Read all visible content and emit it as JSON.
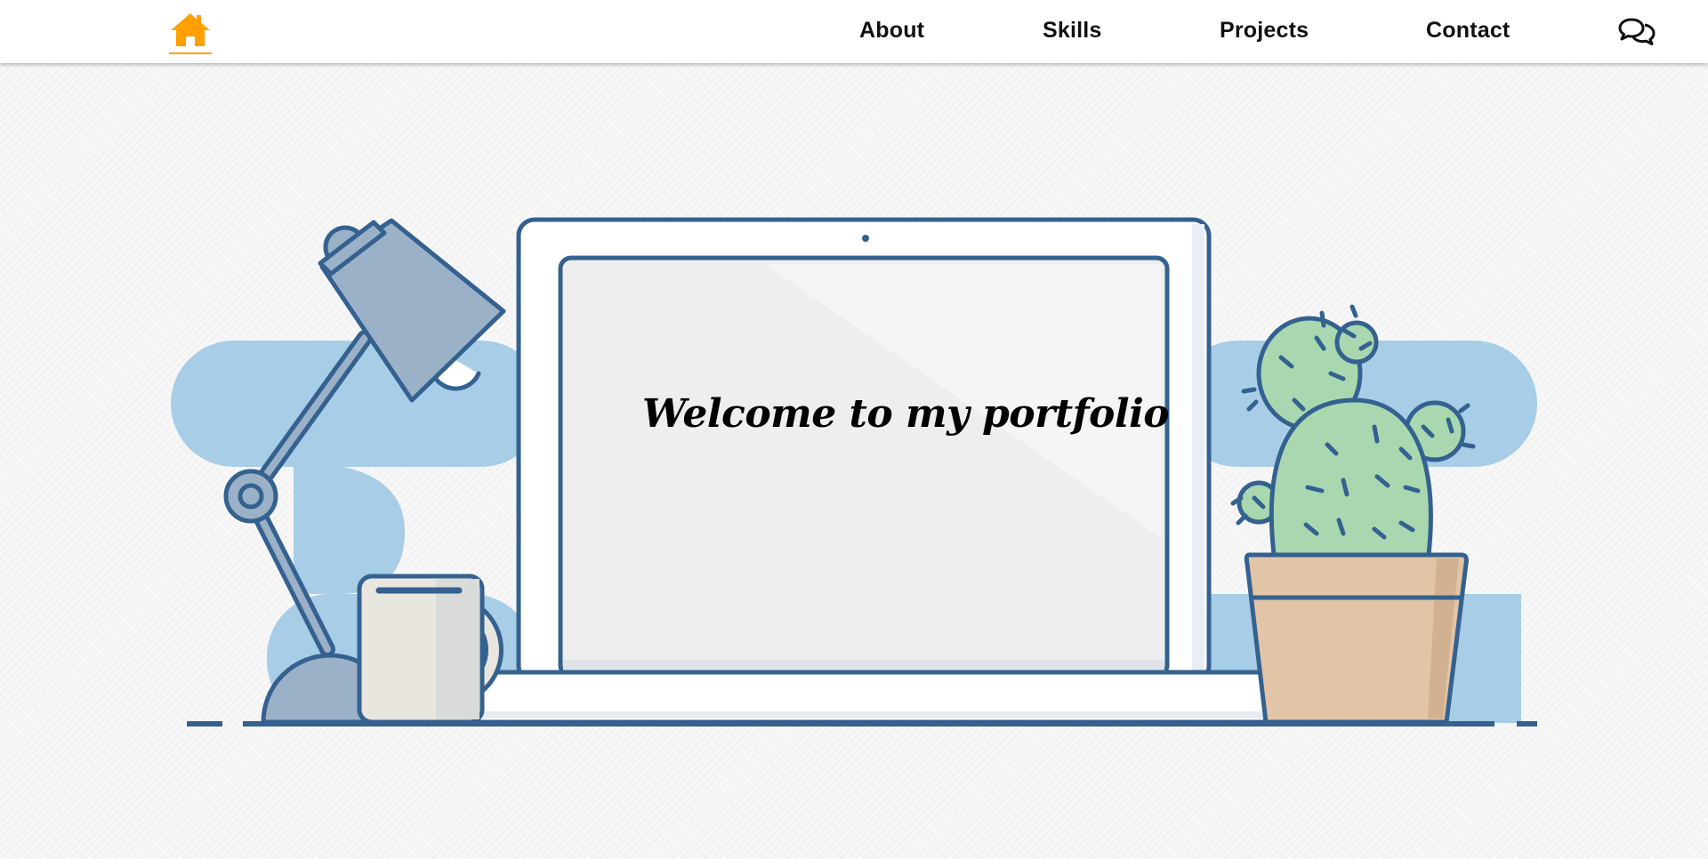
{
  "nav": {
    "home_icon": "home-icon",
    "items": [
      {
        "label": "About"
      },
      {
        "label": "Skills"
      },
      {
        "label": "Projects"
      },
      {
        "label": "Contact"
      }
    ],
    "chat_icon": "chat-bubbles-icon"
  },
  "hero": {
    "headline": "Welcome to my portfolio",
    "illustration": "desk-with-laptop-lamp-mug-cactus"
  },
  "colors": {
    "accent": "#ffa000",
    "outline": "#34618f",
    "backdrop_blue": "#a7cde7",
    "cactus_green": "#a9d8b0",
    "pot_tan": "#e2c4a6"
  }
}
